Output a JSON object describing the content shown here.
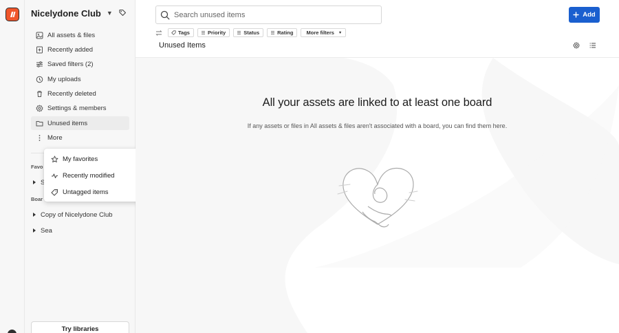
{
  "workspace": {
    "name": "Nicelydone Club"
  },
  "sidebar": {
    "items": [
      {
        "label": "All assets & files",
        "icon": "stack-icon"
      },
      {
        "label": "Recently added",
        "icon": "plus-square-icon"
      },
      {
        "label": "Saved filters (2)",
        "icon": "filter-lines-icon"
      },
      {
        "label": "My uploads",
        "icon": "clock-icon"
      },
      {
        "label": "Recently deleted",
        "icon": "trash-icon"
      },
      {
        "label": "Settings & members",
        "icon": "gear-icon"
      },
      {
        "label": "Unused items",
        "icon": "folder-icon",
        "active": true
      },
      {
        "label": "More",
        "icon": "more-vertical-icon"
      }
    ],
    "favorites_label": "Favo",
    "favorites_item": "S",
    "boards_label": "Boar",
    "boards": [
      {
        "label": "Copy of Nicelydone Club"
      },
      {
        "label": "Sea"
      }
    ],
    "try_libraries": "Try libraries"
  },
  "more_menu": {
    "items": [
      {
        "label": "My favorites",
        "icon": "star-icon"
      },
      {
        "label": "Recently modified",
        "icon": "activity-icon"
      },
      {
        "label": "Untagged items",
        "icon": "tag-icon"
      }
    ]
  },
  "search": {
    "placeholder": "Search unused items",
    "value": ""
  },
  "toolbar": {
    "add_label": "Add"
  },
  "filters": [
    {
      "label": "Tags"
    },
    {
      "label": "Priority"
    },
    {
      "label": "Status"
    },
    {
      "label": "Rating"
    },
    {
      "label": "More filters"
    }
  ],
  "page": {
    "title": "Unused Items"
  },
  "empty_state": {
    "title": "All your assets are linked to at least one board",
    "subtitle": "If any assets or files in All assets & files aren't associated with a board, you can find them here."
  },
  "colors": {
    "accent": "#1a5fcf",
    "logo": "#f0562b"
  }
}
